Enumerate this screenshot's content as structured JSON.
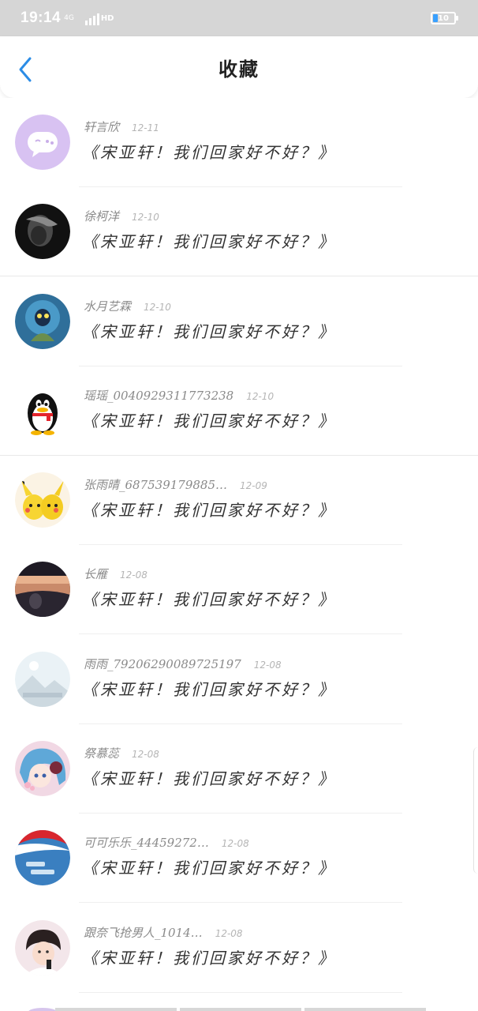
{
  "status_bar": {
    "time": "19:14",
    "network": "4G",
    "hd": "HD",
    "battery": "10",
    "battery_color": "#39a0ff"
  },
  "nav": {
    "title": "收藏",
    "back_icon": "chevron-left-icon",
    "accent_color": "#2b8ce6"
  },
  "items": [
    {
      "name": "轩言欣",
      "date": "12-11",
      "quote": "《宋亚轩！我们回家好不好？》",
      "avatar": "purple-chat-avatar"
    },
    {
      "name": "徐柯洋",
      "date": "12-10",
      "quote": "《宋亚轩！我们回家好不好？》",
      "avatar": "dark-hand-avatar"
    },
    {
      "name": "水月艺霖",
      "date": "12-10",
      "quote": "《宋亚轩！我们回家好不好？》",
      "avatar": "game-character-avatar"
    },
    {
      "name": "瑶瑶_0040929311773238",
      "date": "12-10",
      "quote": "《宋亚轩！我们回家好不好？》",
      "avatar": "qq-penguin-avatar"
    },
    {
      "name": "张雨晴_687539179885…",
      "date": "12-09",
      "quote": "《宋亚轩！我们回家好不好？》",
      "avatar": "pikachu-avatar"
    },
    {
      "name": "长雁",
      "date": "12-08",
      "quote": "《宋亚轩！我们回家好不好？》",
      "avatar": "car-interior-avatar"
    },
    {
      "name": "雨雨_79206290089725197",
      "date": "12-08",
      "quote": "《宋亚轩！我们回家好不好？》",
      "avatar": "default-landscape-avatar"
    },
    {
      "name": "祭慕蕊",
      "date": "12-08",
      "quote": "《宋亚轩！我们回家好不好？》",
      "avatar": "anime-girl-avatar"
    },
    {
      "name": "可可乐乐_44459272…",
      "date": "12-08",
      "quote": "《宋亚轩！我们回家好不好？》",
      "avatar": "pepsi-avatar"
    },
    {
      "name": "跟奈飞抢男人_1014…",
      "date": "12-08",
      "quote": "《宋亚轩！我们回家好不好？》",
      "avatar": "person-photo-avatar"
    }
  ]
}
